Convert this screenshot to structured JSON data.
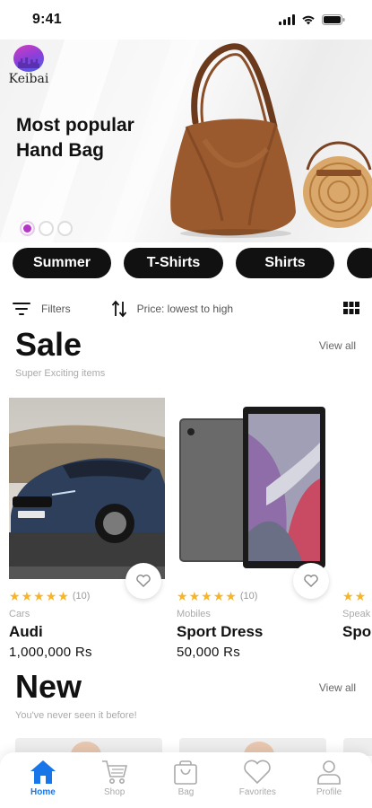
{
  "status": {
    "time": "9:41"
  },
  "hero": {
    "logo_text": "Keibai",
    "title_line1": "Most popular",
    "title_line2": "Hand Bag",
    "dots": 3,
    "active_dot": 0
  },
  "categories": [
    "Summer",
    "T-Shirts",
    "Shirts",
    ""
  ],
  "filters": {
    "filter_label": "Filters",
    "sort_label": "Price: lowest to high",
    "filter_icon": "filter-icon",
    "sort_icon": "sort-icon",
    "view_icon": "grid-view-icon"
  },
  "sale": {
    "title": "Sale",
    "subtitle": "Super Exciting items",
    "view_all": "View all",
    "products": [
      {
        "category": "Cars",
        "name": "Audi",
        "price": "1,000,000 Rs",
        "rating": 5,
        "reviews": "(10)"
      },
      {
        "category": "Mobiles",
        "name": "Sport Dress",
        "price": "50,000 Rs",
        "rating": 5,
        "reviews": "(10)"
      },
      {
        "category": "Speak",
        "name": "Spo",
        "price": "",
        "rating": 5,
        "reviews": ""
      }
    ]
  },
  "new": {
    "title": "New",
    "subtitle": "You've never seen it before!",
    "view_all": "View all"
  },
  "tabbar": {
    "active": "Home",
    "items": [
      {
        "label": "Home",
        "icon": "home-icon"
      },
      {
        "label": "Shop",
        "icon": "cart-icon"
      },
      {
        "label": "Bag",
        "icon": "bag-icon"
      },
      {
        "label": "Favorites",
        "icon": "heart-icon"
      },
      {
        "label": "Profile",
        "icon": "profile-icon"
      }
    ]
  },
  "colors": {
    "accent": "#b733c9",
    "tab_active": "#1976e8",
    "star": "#f7b429",
    "chip_bg": "#111111"
  }
}
